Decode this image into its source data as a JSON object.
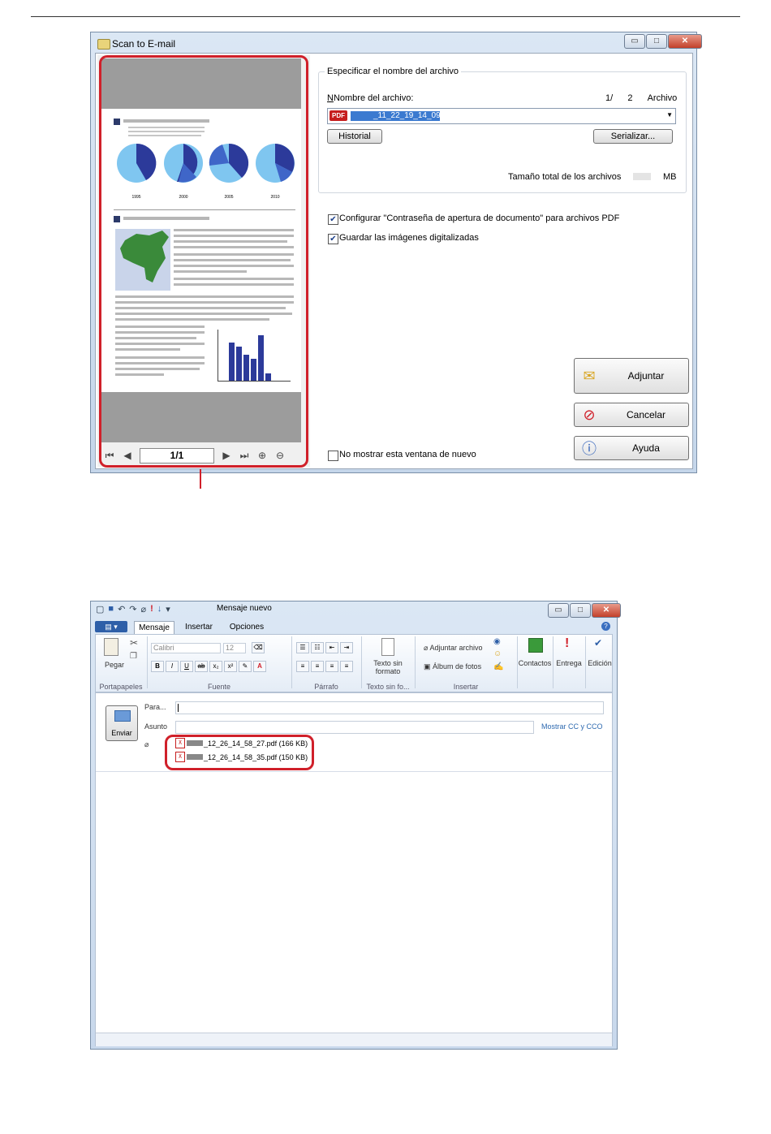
{
  "scan_window": {
    "title": "Scan to E-mail",
    "preview": {
      "page_indicator": "1/1",
      "years": [
        "1995",
        "2000",
        "2005",
        "2010"
      ]
    },
    "file_group_legend": "Especificar el nombre del archivo",
    "filename_label": "Nombre del archivo:",
    "file_count_current": "1/",
    "file_count_total": "2",
    "file_count_unit": "Archivo",
    "filename_value": "_11_22_19_14_09",
    "pdf_badge": "PDF",
    "history_button": "Historial",
    "serialize_button": "Serializar...",
    "total_size_label": "Tamaño total de los archivos",
    "total_size_unit": "MB",
    "opt_password": "Configurar \"Contraseña de apertura de documento\" para archivos PDF",
    "opt_password_checked": true,
    "opt_save": "Guardar las imágenes digitalizadas",
    "opt_save_checked": true,
    "attach_button": "Adjuntar",
    "cancel_button": "Cancelar",
    "help_button": "Ayuda",
    "dont_show": "No mostrar esta ventana de nuevo",
    "dont_show_checked": false
  },
  "mail_window": {
    "title": "Mensaje nuevo",
    "tabs": [
      "Mensaje",
      "Insertar",
      "Opciones"
    ],
    "font_name": "Calibri",
    "font_size": "12",
    "groups": {
      "clipboard": "Portapapeles",
      "font": "Fuente",
      "paragraph": "Párrafo",
      "plaintext": "Texto sin fo...",
      "insert": "Insertar"
    },
    "paste_label": "Pegar",
    "plaintext_label_1": "Texto sin",
    "plaintext_label_2": "formato",
    "attach_file": "Adjuntar archivo",
    "photo_album": "Álbum de fotos",
    "contacts": "Contactos",
    "delivery": "Entrega",
    "editing": "Edición",
    "send_button": "Enviar",
    "to_label": "Para...",
    "subject_label": "Asunto",
    "show_cc": "Mostrar CC y CCO",
    "attachments": [
      "_12_26_14_58_27.pdf (166 KB)",
      "_12_26_14_58_35.pdf (150 KB)"
    ]
  },
  "colors": {
    "highlight": "#d0202a",
    "selection": "#3b7ad0",
    "chart_blue": "#2c3a9a",
    "chart_light": "#7fc6f0"
  }
}
